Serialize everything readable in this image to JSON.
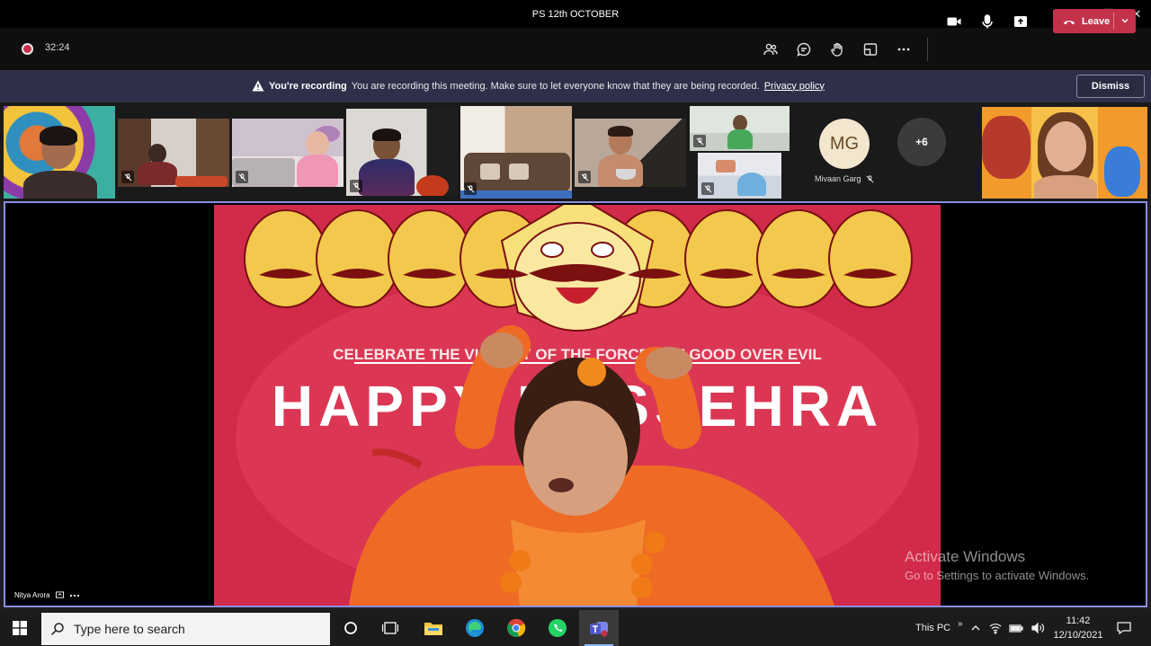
{
  "window": {
    "title": "PS 12th OCTOBER",
    "minimize": "—",
    "restore": "❐",
    "close": "✕"
  },
  "toolbar": {
    "timer": "32:24",
    "leave_label": "Leave"
  },
  "banner": {
    "heading": "You're recording",
    "message": "You are recording this meeting. Make sure to let everyone know that they are being recorded.",
    "link": "Privacy policy",
    "dismiss_label": "Dismiss"
  },
  "participants": {
    "avatar_initials": "MG",
    "avatar_name": "Mivaan Garg",
    "overflow_count": "+6"
  },
  "stage": {
    "speaker_name": "Nitya Arora",
    "poster_tagline": "CELEBRATE THE VICTORY OF THE FORCES OF GOOD OVER EVIL",
    "poster_title": "HAPPY DUSSEHRA"
  },
  "watermark": {
    "line1": "Activate Windows",
    "line2": "Go to Settings to activate Windows."
  },
  "taskbar": {
    "search_placeholder": "Type here to search",
    "this_pc": "This PC",
    "time": "11:42",
    "date": "12/10/2021"
  },
  "colors": {
    "leave": "#c4314b",
    "banner": "#2f2f4a",
    "stage_border": "#8a8ee0",
    "poster": "#d12a4a"
  }
}
